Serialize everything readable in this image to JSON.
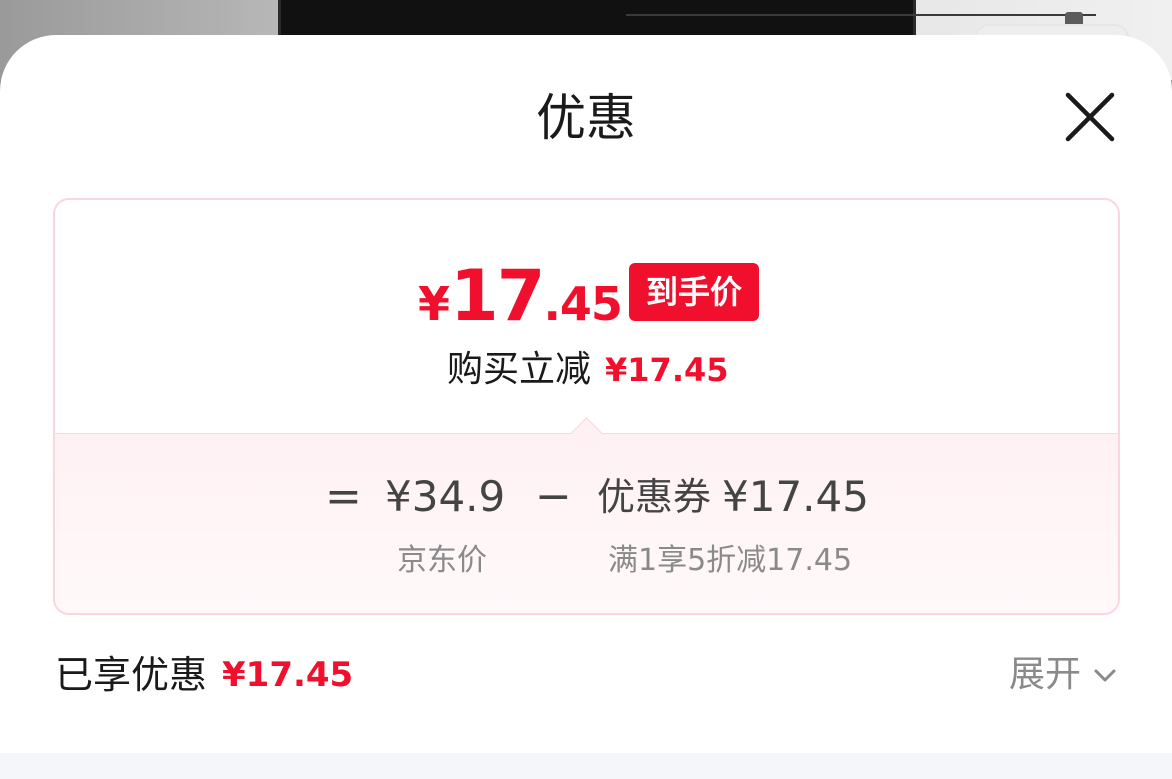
{
  "dialog": {
    "title": "优惠"
  },
  "price_card": {
    "final_price_symbol": "¥",
    "final_price_integer": "17",
    "final_price_decimal": ".45",
    "final_price_badge": "到手价",
    "reduce_label": "购买立减",
    "reduce_amount": "¥17.45",
    "formula": {
      "equals": "=",
      "jd_price": "¥34.9",
      "minus": "−",
      "coupon_label": "优惠券",
      "coupon_amount": "¥17.45"
    },
    "formula_captions": {
      "jd_price_caption": "京东价",
      "coupon_caption": "满1享5折减17.45"
    }
  },
  "summary": {
    "enjoyed_label": "已享优惠",
    "enjoyed_amount": "¥17.45",
    "expand_label": "展开"
  },
  "icons": {
    "close": "close-icon",
    "expand": "chevron-down-icon"
  },
  "colors": {
    "accent_red": "#f0102d",
    "card_border": "#fbd6df",
    "card_tint": "#fff1f3",
    "muted_text": "#8a8a8a"
  }
}
